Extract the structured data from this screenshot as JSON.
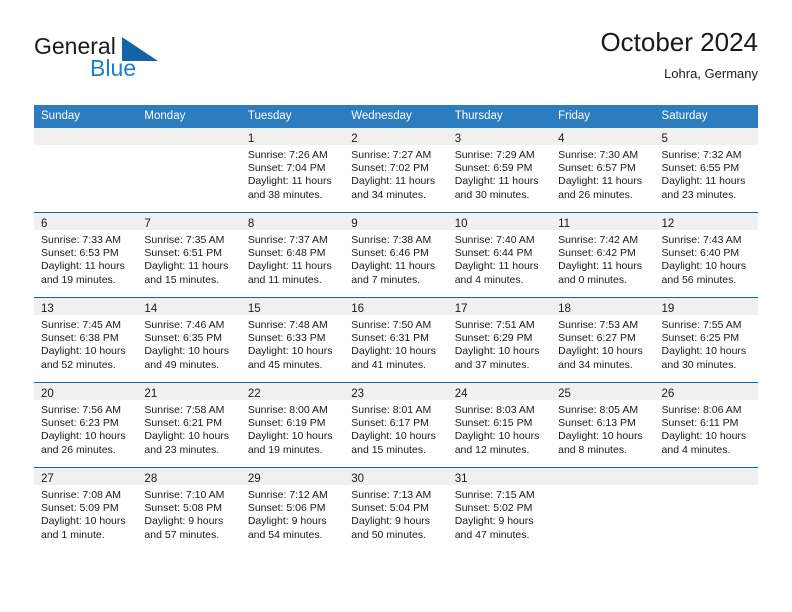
{
  "brand": {
    "name_top": "General",
    "name_bottom": "Blue",
    "color_top": "#1a1a1a",
    "color_bottom": "#1f7ec4",
    "triangle_color": "#1464a5"
  },
  "header": {
    "title": "October 2024",
    "subtitle": "Lohra, Germany"
  },
  "theme": {
    "header_bg": "#2d7cc0",
    "header_text": "#ffffff",
    "row_divider": "#1464a5",
    "daynum_band": "#f0f0f0",
    "body_text": "#1a1a1a"
  },
  "weekdays": [
    "Sunday",
    "Monday",
    "Tuesday",
    "Wednesday",
    "Thursday",
    "Friday",
    "Saturday"
  ],
  "weeks": [
    [
      {
        "day": "",
        "sunrise": "",
        "sunset": "",
        "daylight1": "",
        "daylight2": "",
        "empty": true
      },
      {
        "day": "",
        "sunrise": "",
        "sunset": "",
        "daylight1": "",
        "daylight2": "",
        "empty": true
      },
      {
        "day": "1",
        "sunrise": "Sunrise: 7:26 AM",
        "sunset": "Sunset: 7:04 PM",
        "daylight1": "Daylight: 11 hours",
        "daylight2": "and 38 minutes."
      },
      {
        "day": "2",
        "sunrise": "Sunrise: 7:27 AM",
        "sunset": "Sunset: 7:02 PM",
        "daylight1": "Daylight: 11 hours",
        "daylight2": "and 34 minutes."
      },
      {
        "day": "3",
        "sunrise": "Sunrise: 7:29 AM",
        "sunset": "Sunset: 6:59 PM",
        "daylight1": "Daylight: 11 hours",
        "daylight2": "and 30 minutes."
      },
      {
        "day": "4",
        "sunrise": "Sunrise: 7:30 AM",
        "sunset": "Sunset: 6:57 PM",
        "daylight1": "Daylight: 11 hours",
        "daylight2": "and 26 minutes."
      },
      {
        "day": "5",
        "sunrise": "Sunrise: 7:32 AM",
        "sunset": "Sunset: 6:55 PM",
        "daylight1": "Daylight: 11 hours",
        "daylight2": "and 23 minutes."
      }
    ],
    [
      {
        "day": "6",
        "sunrise": "Sunrise: 7:33 AM",
        "sunset": "Sunset: 6:53 PM",
        "daylight1": "Daylight: 11 hours",
        "daylight2": "and 19 minutes."
      },
      {
        "day": "7",
        "sunrise": "Sunrise: 7:35 AM",
        "sunset": "Sunset: 6:51 PM",
        "daylight1": "Daylight: 11 hours",
        "daylight2": "and 15 minutes."
      },
      {
        "day": "8",
        "sunrise": "Sunrise: 7:37 AM",
        "sunset": "Sunset: 6:48 PM",
        "daylight1": "Daylight: 11 hours",
        "daylight2": "and 11 minutes."
      },
      {
        "day": "9",
        "sunrise": "Sunrise: 7:38 AM",
        "sunset": "Sunset: 6:46 PM",
        "daylight1": "Daylight: 11 hours",
        "daylight2": "and 7 minutes."
      },
      {
        "day": "10",
        "sunrise": "Sunrise: 7:40 AM",
        "sunset": "Sunset: 6:44 PM",
        "daylight1": "Daylight: 11 hours",
        "daylight2": "and 4 minutes."
      },
      {
        "day": "11",
        "sunrise": "Sunrise: 7:42 AM",
        "sunset": "Sunset: 6:42 PM",
        "daylight1": "Daylight: 11 hours",
        "daylight2": "and 0 minutes."
      },
      {
        "day": "12",
        "sunrise": "Sunrise: 7:43 AM",
        "sunset": "Sunset: 6:40 PM",
        "daylight1": "Daylight: 10 hours",
        "daylight2": "and 56 minutes."
      }
    ],
    [
      {
        "day": "13",
        "sunrise": "Sunrise: 7:45 AM",
        "sunset": "Sunset: 6:38 PM",
        "daylight1": "Daylight: 10 hours",
        "daylight2": "and 52 minutes."
      },
      {
        "day": "14",
        "sunrise": "Sunrise: 7:46 AM",
        "sunset": "Sunset: 6:35 PM",
        "daylight1": "Daylight: 10 hours",
        "daylight2": "and 49 minutes."
      },
      {
        "day": "15",
        "sunrise": "Sunrise: 7:48 AM",
        "sunset": "Sunset: 6:33 PM",
        "daylight1": "Daylight: 10 hours",
        "daylight2": "and 45 minutes."
      },
      {
        "day": "16",
        "sunrise": "Sunrise: 7:50 AM",
        "sunset": "Sunset: 6:31 PM",
        "daylight1": "Daylight: 10 hours",
        "daylight2": "and 41 minutes."
      },
      {
        "day": "17",
        "sunrise": "Sunrise: 7:51 AM",
        "sunset": "Sunset: 6:29 PM",
        "daylight1": "Daylight: 10 hours",
        "daylight2": "and 37 minutes."
      },
      {
        "day": "18",
        "sunrise": "Sunrise: 7:53 AM",
        "sunset": "Sunset: 6:27 PM",
        "daylight1": "Daylight: 10 hours",
        "daylight2": "and 34 minutes."
      },
      {
        "day": "19",
        "sunrise": "Sunrise: 7:55 AM",
        "sunset": "Sunset: 6:25 PM",
        "daylight1": "Daylight: 10 hours",
        "daylight2": "and 30 minutes."
      }
    ],
    [
      {
        "day": "20",
        "sunrise": "Sunrise: 7:56 AM",
        "sunset": "Sunset: 6:23 PM",
        "daylight1": "Daylight: 10 hours",
        "daylight2": "and 26 minutes."
      },
      {
        "day": "21",
        "sunrise": "Sunrise: 7:58 AM",
        "sunset": "Sunset: 6:21 PM",
        "daylight1": "Daylight: 10 hours",
        "daylight2": "and 23 minutes."
      },
      {
        "day": "22",
        "sunrise": "Sunrise: 8:00 AM",
        "sunset": "Sunset: 6:19 PM",
        "daylight1": "Daylight: 10 hours",
        "daylight2": "and 19 minutes."
      },
      {
        "day": "23",
        "sunrise": "Sunrise: 8:01 AM",
        "sunset": "Sunset: 6:17 PM",
        "daylight1": "Daylight: 10 hours",
        "daylight2": "and 15 minutes."
      },
      {
        "day": "24",
        "sunrise": "Sunrise: 8:03 AM",
        "sunset": "Sunset: 6:15 PM",
        "daylight1": "Daylight: 10 hours",
        "daylight2": "and 12 minutes."
      },
      {
        "day": "25",
        "sunrise": "Sunrise: 8:05 AM",
        "sunset": "Sunset: 6:13 PM",
        "daylight1": "Daylight: 10 hours",
        "daylight2": "and 8 minutes."
      },
      {
        "day": "26",
        "sunrise": "Sunrise: 8:06 AM",
        "sunset": "Sunset: 6:11 PM",
        "daylight1": "Daylight: 10 hours",
        "daylight2": "and 4 minutes."
      }
    ],
    [
      {
        "day": "27",
        "sunrise": "Sunrise: 7:08 AM",
        "sunset": "Sunset: 5:09 PM",
        "daylight1": "Daylight: 10 hours",
        "daylight2": "and 1 minute."
      },
      {
        "day": "28",
        "sunrise": "Sunrise: 7:10 AM",
        "sunset": "Sunset: 5:08 PM",
        "daylight1": "Daylight: 9 hours",
        "daylight2": "and 57 minutes."
      },
      {
        "day": "29",
        "sunrise": "Sunrise: 7:12 AM",
        "sunset": "Sunset: 5:06 PM",
        "daylight1": "Daylight: 9 hours",
        "daylight2": "and 54 minutes."
      },
      {
        "day": "30",
        "sunrise": "Sunrise: 7:13 AM",
        "sunset": "Sunset: 5:04 PM",
        "daylight1": "Daylight: 9 hours",
        "daylight2": "and 50 minutes."
      },
      {
        "day": "31",
        "sunrise": "Sunrise: 7:15 AM",
        "sunset": "Sunset: 5:02 PM",
        "daylight1": "Daylight: 9 hours",
        "daylight2": "and 47 minutes."
      },
      {
        "day": "",
        "sunrise": "",
        "sunset": "",
        "daylight1": "",
        "daylight2": "",
        "empty": true
      },
      {
        "day": "",
        "sunrise": "",
        "sunset": "",
        "daylight1": "",
        "daylight2": "",
        "empty": true
      }
    ]
  ]
}
